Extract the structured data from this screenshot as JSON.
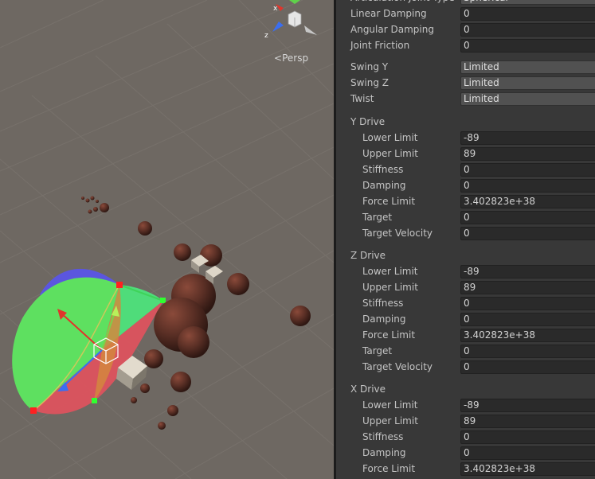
{
  "scene": {
    "gizmo_axis_x": "x",
    "gizmo_axis_z": "z",
    "projection_label": "Persp",
    "projection_icon": "persp-chevron-icon"
  },
  "inspector": {
    "top_row": {
      "label": "Articulation Joint Type",
      "value": "Spherical"
    },
    "props": [
      {
        "label": "Linear Damping",
        "value": "0"
      },
      {
        "label": "Angular Damping",
        "value": "0"
      },
      {
        "label": "Joint Friction",
        "value": "0"
      }
    ],
    "motion": [
      {
        "label": "Swing Y",
        "value": "Limited"
      },
      {
        "label": "Swing Z",
        "value": "Limited"
      },
      {
        "label": "Twist",
        "value": "Limited"
      }
    ],
    "drives": [
      {
        "title": "Y Drive",
        "fields": [
          {
            "label": "Lower Limit",
            "value": "-89"
          },
          {
            "label": "Upper Limit",
            "value": "89"
          },
          {
            "label": "Stiffness",
            "value": "0"
          },
          {
            "label": "Damping",
            "value": "0"
          },
          {
            "label": "Force Limit",
            "value": "3.402823e+38"
          },
          {
            "label": "Target",
            "value": "0"
          },
          {
            "label": "Target Velocity",
            "value": "0"
          }
        ]
      },
      {
        "title": "Z Drive",
        "fields": [
          {
            "label": "Lower Limit",
            "value": "-89"
          },
          {
            "label": "Upper Limit",
            "value": "89"
          },
          {
            "label": "Stiffness",
            "value": "0"
          },
          {
            "label": "Damping",
            "value": "0"
          },
          {
            "label": "Force Limit",
            "value": "3.402823e+38"
          },
          {
            "label": "Target",
            "value": "0"
          },
          {
            "label": "Target Velocity",
            "value": "0"
          }
        ]
      },
      {
        "title": "X Drive",
        "fields": [
          {
            "label": "Lower Limit",
            "value": "-89"
          },
          {
            "label": "Upper Limit",
            "value": "89"
          },
          {
            "label": "Stiffness",
            "value": "0"
          },
          {
            "label": "Damping",
            "value": "0"
          },
          {
            "label": "Force Limit",
            "value": "3.402823e+38"
          }
        ]
      }
    ]
  },
  "colors": {
    "scene_bg": "#6e6862",
    "panel_bg": "#383838",
    "field_bg": "#2a2a2a",
    "dropdown_bg": "#515151",
    "gizmo_x": "#e0342b",
    "gizmo_y": "#7bd14a",
    "gizmo_z": "#3b6ef0",
    "sphere": "#5a2f25"
  }
}
